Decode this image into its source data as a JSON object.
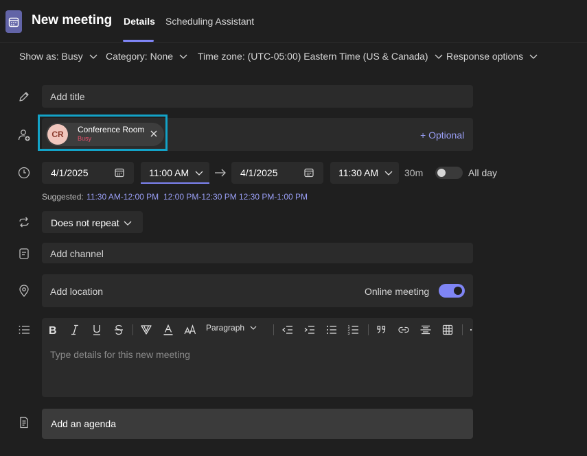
{
  "header": {
    "title": "New meeting",
    "tabs": [
      {
        "label": "Details",
        "active": true
      },
      {
        "label": "Scheduling Assistant",
        "active": false
      }
    ]
  },
  "options": {
    "show_as": "Show as: Busy",
    "category": "Category: None",
    "time_zone": "Time zone: (UTC-05:00) Eastern Time (US & Canada)",
    "response_options": "Response options"
  },
  "title_field": {
    "placeholder": "Add title"
  },
  "attendees": {
    "chip": {
      "initials": "CR",
      "name": "Conference Room",
      "status": "Busy"
    },
    "optional_label": "+ Optional"
  },
  "datetime": {
    "start_date": "4/1/2025",
    "start_time": "11:00 AM",
    "end_date": "4/1/2025",
    "end_time": "11:30 AM",
    "duration": "30m",
    "all_day_label": "All day",
    "all_day": false
  },
  "suggested": {
    "label": "Suggested:",
    "slots": [
      "11:30 AM-12:00 PM",
      "12:00 PM-12:30 PM",
      "12:30 PM-1:00 PM"
    ]
  },
  "repeat": {
    "value": "Does not repeat"
  },
  "channel": {
    "placeholder": "Add channel"
  },
  "location": {
    "placeholder": "Add location",
    "online_label": "Online meeting",
    "online": true
  },
  "editor": {
    "paragraph_label": "Paragraph",
    "placeholder": "Type details for this new meeting"
  },
  "agenda": {
    "label": "Add an agenda"
  },
  "colors": {
    "accent": "#7f85f5",
    "highlight": "#13a3c8",
    "busy": "#e8506b",
    "background": "#1f1f1f",
    "field": "#2b2b2b"
  }
}
